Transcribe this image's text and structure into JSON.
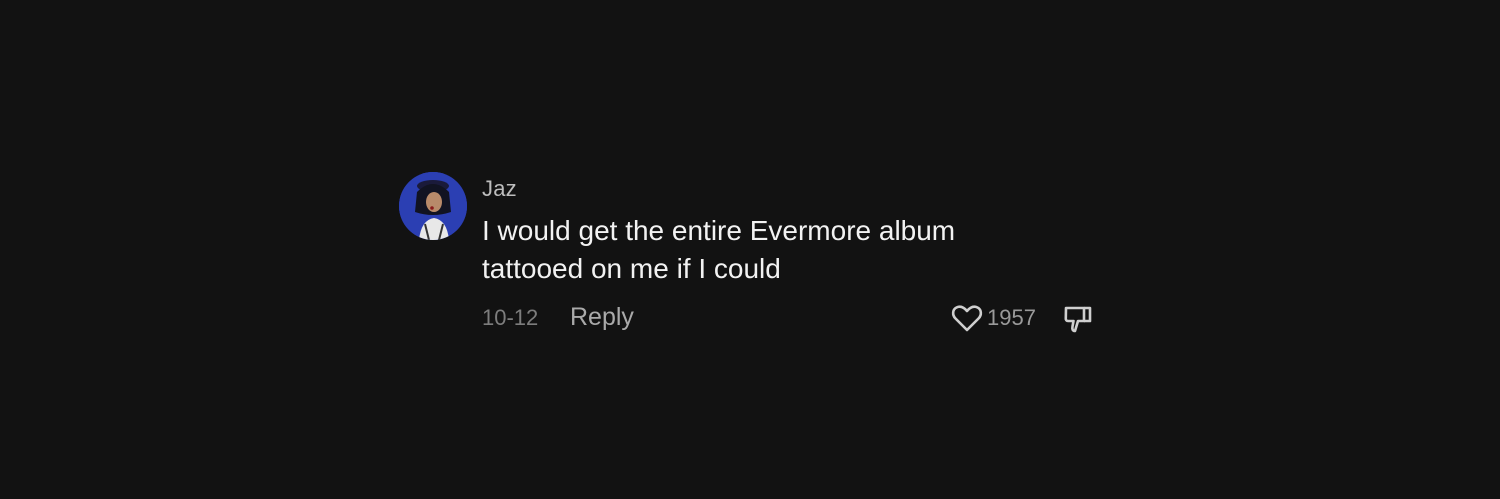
{
  "comment": {
    "username": "Jaz",
    "text_line1": "I would get the entire Evermore album",
    "text_line2": "tattooed on me if I could",
    "date": "10-12",
    "reply_label": "Reply",
    "like_count": "1957",
    "icons": {
      "avatar": "avatar",
      "like": "heart-icon",
      "dislike": "thumbs-down-icon"
    },
    "colors": {
      "background": "#121212",
      "username": "#bdbdbd",
      "text": "#f2f2f2",
      "date": "#7d7d7d",
      "reply": "#a9a9a9"
    }
  }
}
